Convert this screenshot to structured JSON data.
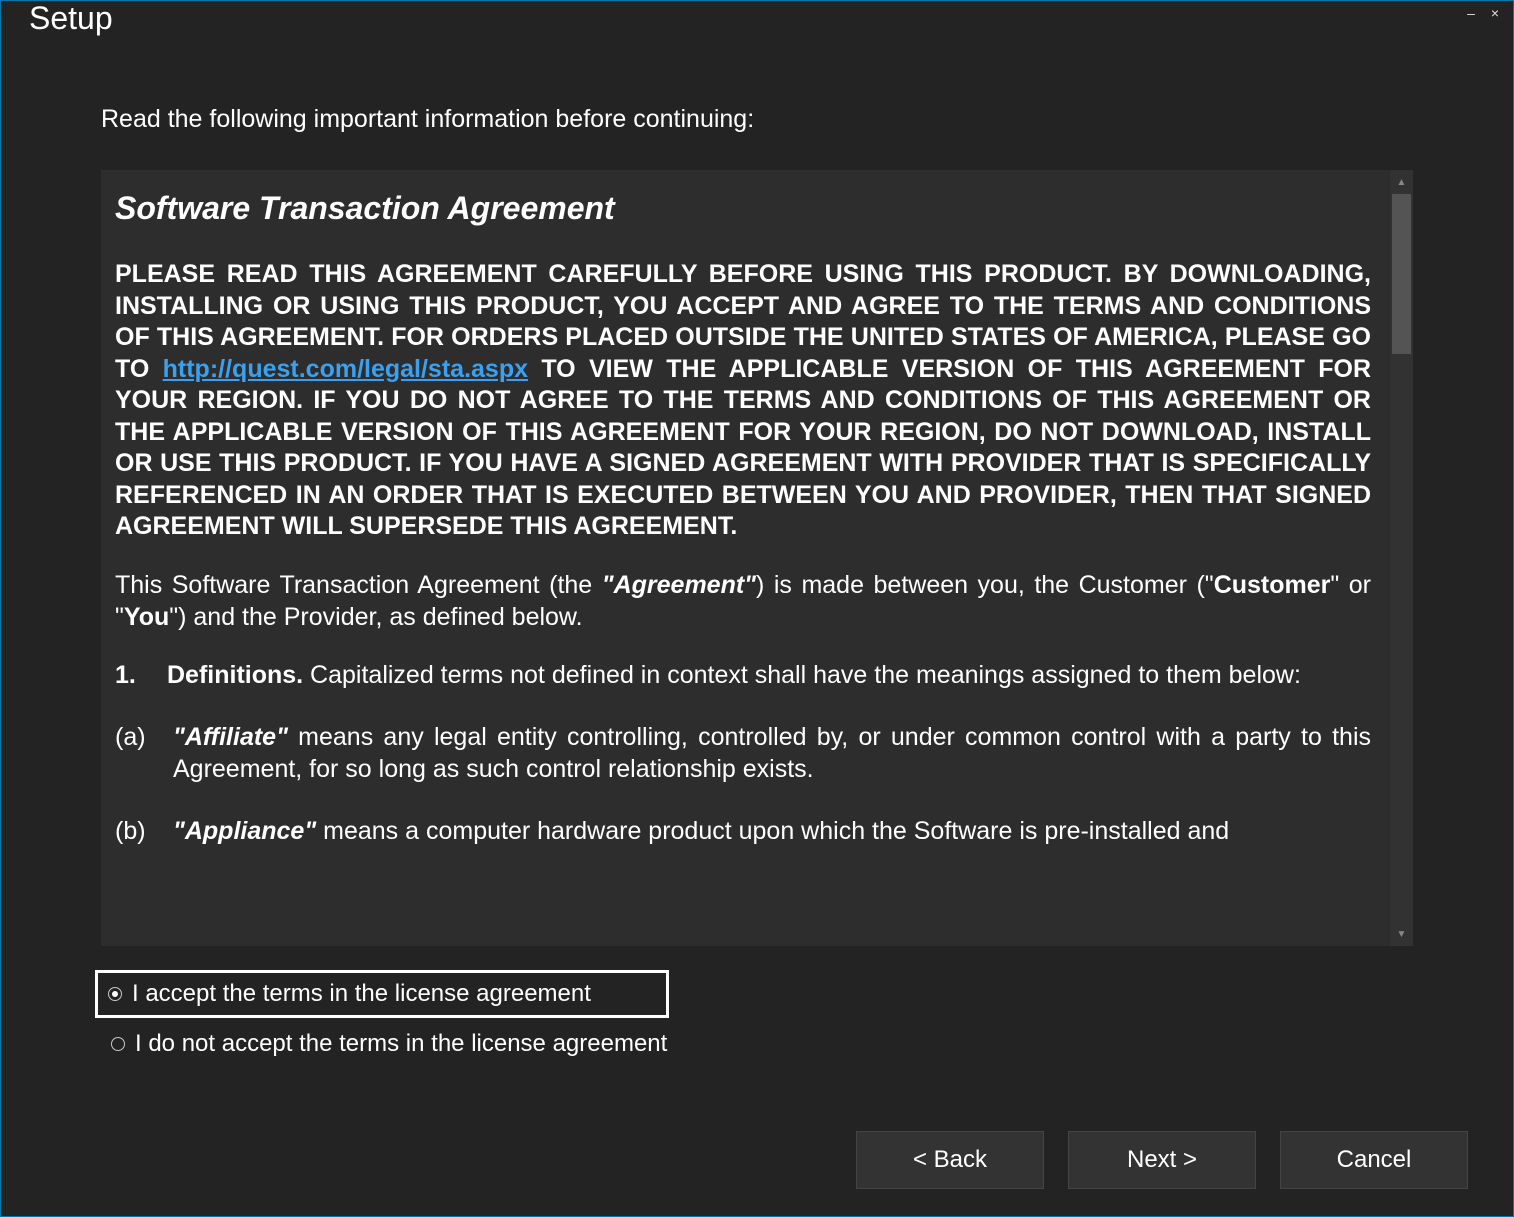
{
  "window": {
    "title": "Setup"
  },
  "page": {
    "intro": "Read the following important information before continuing:"
  },
  "license": {
    "title": "Software Transaction Agreement",
    "intro_pre": "PLEASE READ THIS AGREEMENT CAREFULLY BEFORE USING THIS PRODUCT. BY DOWNLOADING, INSTALLING OR USING THIS PRODUCT, YOU ACCEPT AND AGREE TO THE TERMS AND CONDITIONS OF THIS AGREEMENT. FOR ORDERS PLACED OUTSIDE THE UNITED STATES OF AMERICA, PLEASE GO TO ",
    "intro_link": "http://quest.com/legal/sta.aspx",
    "intro_post": " TO VIEW THE APPLICABLE VERSION OF THIS AGREEMENT FOR YOUR REGION. IF YOU DO NOT AGREE TO THE TERMS AND CONDITIONS OF THIS AGREEMENT OR THE APPLICABLE VERSION OF THIS AGREEMENT FOR YOUR REGION, DO NOT DOWNLOAD, INSTALL OR USE THIS PRODUCT. IF YOU HAVE A SIGNED AGREEMENT WITH PROVIDER THAT IS SPECIFICALLY REFERENCED IN AN ORDER THAT IS EXECUTED BETWEEN YOU AND PROVIDER, THEN THAT SIGNED AGREEMENT WILL SUPERSEDE THIS AGREEMENT.",
    "para2_1": "This Software Transaction Agreement (the ",
    "para2_2": "\"Agreement\"",
    "para2_3": ") is made between you, the Customer (\"",
    "para2_4": "Customer",
    "para2_5": "\" or \"",
    "para2_6": "You",
    "para2_7": "\") and the Provider, as defined below.",
    "defs_num": "1.",
    "defs_head": "Definitions.",
    "defs_tail": " Capitalized terms not defined in context shall have the meanings assigned to them below:",
    "def_a_tag": "(a)",
    "def_a_term": "\"Affiliate\"",
    "def_a_text": " means any legal entity controlling, controlled by, or under common control with a party to this Agreement, for so long as such control relationship exists.",
    "def_b_tag": "(b)",
    "def_b_term": "\"Appliance\"",
    "def_b_text": " means a computer hardware product upon which the Software is pre-installed and"
  },
  "radios": {
    "accept": "I accept the terms in the license agreement",
    "decline": "I do not accept the terms in the license agreement"
  },
  "buttons": {
    "back": "< Back",
    "next": "Next >",
    "cancel": "Cancel"
  }
}
